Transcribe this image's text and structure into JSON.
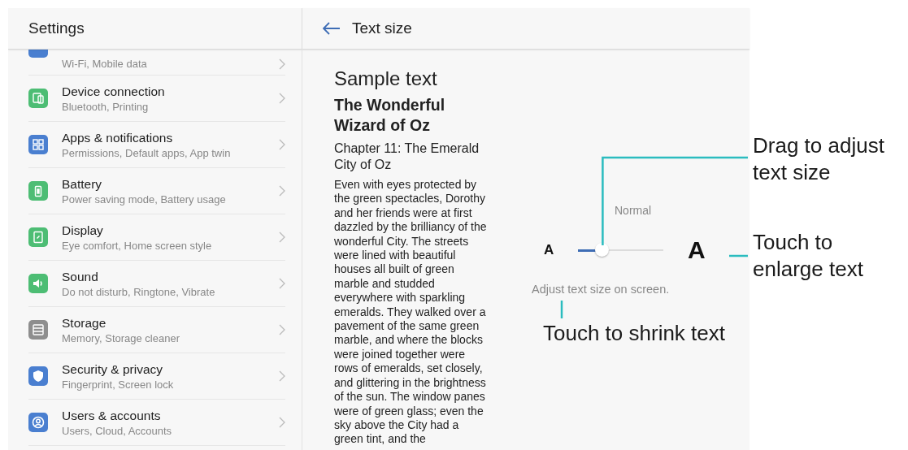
{
  "settings": {
    "title": "Settings",
    "items": [
      {
        "kind": "wifi",
        "color": "#4a7fd0",
        "subtitle": "Wi-Fi, Mobile data"
      },
      {
        "kind": "devices",
        "color": "#4dbd74",
        "title": "Device connection",
        "subtitle": "Bluetooth, Printing"
      },
      {
        "kind": "apps",
        "color": "#4a7fd0",
        "title": "Apps & notifications",
        "subtitle": "Permissions, Default apps, App twin"
      },
      {
        "kind": "battery",
        "color": "#4dbd74",
        "title": "Battery",
        "subtitle": "Power saving mode, Battery usage"
      },
      {
        "kind": "display",
        "color": "#4dbd74",
        "title": "Display",
        "subtitle": "Eye comfort, Home screen style"
      },
      {
        "kind": "sound",
        "color": "#4dbd74",
        "title": "Sound",
        "subtitle": "Do not disturb, Ringtone, Vibrate"
      },
      {
        "kind": "storage",
        "color": "#8e8e8e",
        "title": "Storage",
        "subtitle": "Memory, Storage cleaner"
      },
      {
        "kind": "security",
        "color": "#4a7fd0",
        "title": "Security & privacy",
        "subtitle": "Fingerprint, Screen lock"
      },
      {
        "kind": "users",
        "color": "#4a7fd0",
        "title": "Users & accounts",
        "subtitle": "Users, Cloud, Accounts"
      }
    ]
  },
  "text_size": {
    "title": "Text size",
    "sample_heading": "Sample text",
    "book_title": "The Wonderful Wizard of Oz",
    "chapter": "Chapter 11: The Emerald City of Oz",
    "body": "Even with eyes protected by the green spectacles, Dorothy and her friends were at first dazzled by the brilliancy of the wonderful City. The streets were lined with beautiful houses all built of green marble and studded everywhere with sparkling emeralds. They walked over a pavement of the same green marble, and where the blocks were joined together were rows of emeralds, set closely, and glittering in the brightness of the sun. The window panes were of green glass; even the sky above the City had a green tint, and the",
    "slider": {
      "value_label": "Normal",
      "small_label": "A",
      "large_label": "A",
      "level": 0.28
    },
    "caption": "Adjust text size on screen."
  },
  "callouts": {
    "drag": "Drag to adjust text size",
    "enlarge": "Touch to enlarge text",
    "shrink": "Touch to shrink text"
  }
}
